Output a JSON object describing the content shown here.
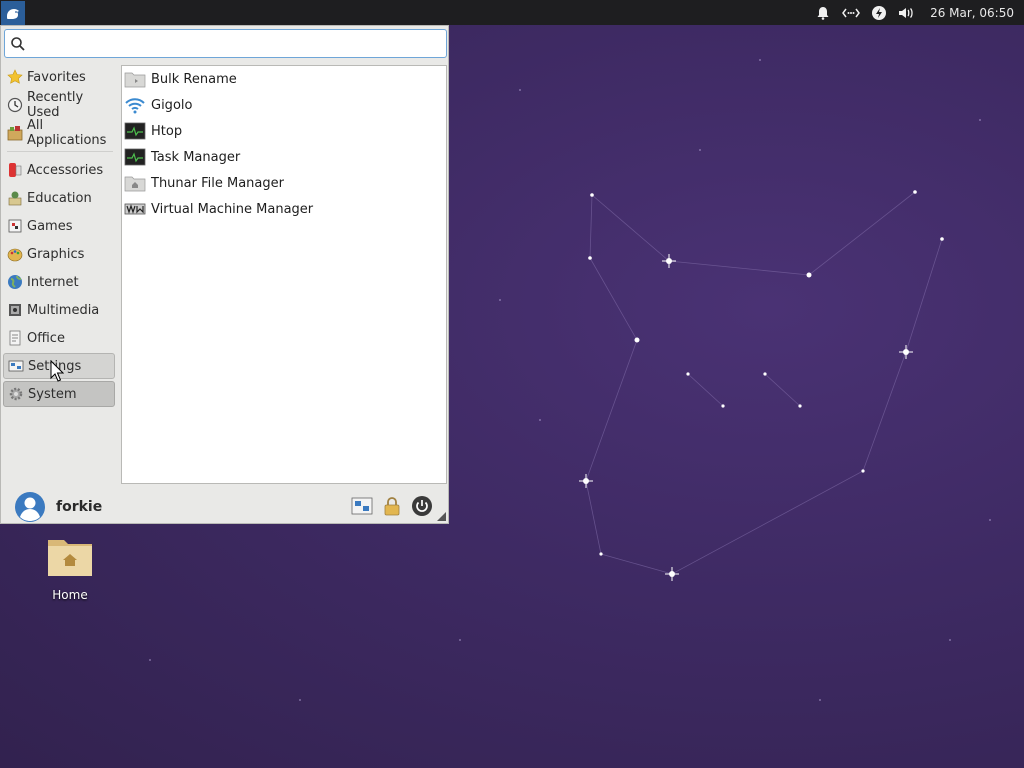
{
  "panel": {
    "clock": "26 Mar, 06:50",
    "tray_icons": [
      "notification-bell-icon",
      "network-icon",
      "power-manager-icon",
      "volume-icon"
    ]
  },
  "search": {
    "value": "",
    "placeholder": ""
  },
  "categories": [
    {
      "label": "Favorites",
      "icon": "star-icon"
    },
    {
      "label": "Recently Used",
      "icon": "clock-icon"
    },
    {
      "label": "All Applications",
      "icon": "applications-icon"
    },
    {
      "label": "Accessories",
      "icon": "accessories-icon"
    },
    {
      "label": "Education",
      "icon": "education-icon"
    },
    {
      "label": "Games",
      "icon": "games-icon"
    },
    {
      "label": "Graphics",
      "icon": "graphics-icon"
    },
    {
      "label": "Internet",
      "icon": "globe-icon"
    },
    {
      "label": "Multimedia",
      "icon": "multimedia-icon"
    },
    {
      "label": "Office",
      "icon": "office-icon"
    },
    {
      "label": "Settings",
      "icon": "settings-icon"
    },
    {
      "label": "System",
      "icon": "system-gear-icon"
    }
  ],
  "applications": [
    {
      "label": "Bulk Rename",
      "icon": "folder-icon"
    },
    {
      "label": "Gigolo",
      "icon": "wifi-icon"
    },
    {
      "label": "Htop",
      "icon": "monitor-icon"
    },
    {
      "label": "Task Manager",
      "icon": "monitor-icon"
    },
    {
      "label": "Thunar File Manager",
      "icon": "folder-icon"
    },
    {
      "label": "Virtual Machine Manager",
      "icon": "vmm-icon"
    }
  ],
  "user": {
    "name": "forkie"
  },
  "desktop": {
    "home_label": "Home"
  },
  "colors": {
    "panel_bg": "#1e1e20",
    "desktop_bg": "#3e2a63",
    "accent": "#2b5e99"
  }
}
